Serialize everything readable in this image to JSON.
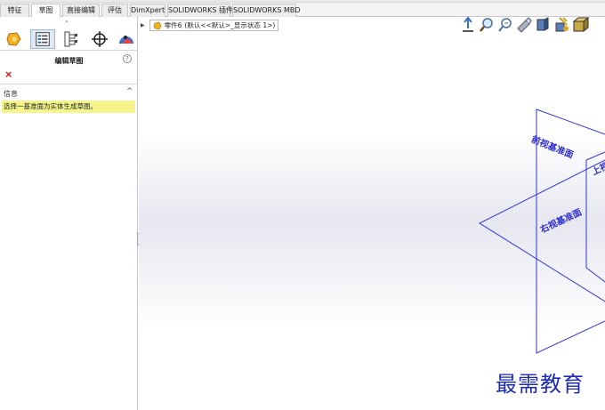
{
  "tabs": [
    {
      "label": "特征",
      "active": false
    },
    {
      "label": "草图",
      "active": true
    },
    {
      "label": "直接编辑",
      "active": false
    },
    {
      "label": "评估",
      "active": false
    },
    {
      "label": "DimXpert",
      "active": false
    },
    {
      "label": "SOLIDWORKS 插件",
      "active": false
    },
    {
      "label": "SOLIDWORKS MBD",
      "active": false
    }
  ],
  "panel": {
    "tick_mark": "»",
    "icon_tabs": [
      "feature-manager-icon",
      "property-manager-icon",
      "configuration-manager-icon",
      "dimxpert-manager-icon",
      "display-manager-icon"
    ],
    "title": "编辑草图",
    "help_icon": "?",
    "close_icon": "×",
    "info_header": "信息",
    "info_message": "选择一基准面为实体生成草图。",
    "collapse_icon": "^"
  },
  "tree": {
    "part_name": "零件6",
    "config_text": "(默认<<默认>_显示状态 1>)"
  },
  "headsup_icons": [
    "view-orientation-icon",
    "zoom-to-fit-icon",
    "zoom-area-icon",
    "previous-view-icon",
    "section-view-icon",
    "dynamic-annotation-icon",
    "display-style-icon"
  ],
  "planes": {
    "front": "前视基准面",
    "top": "上视基准面",
    "right": "右视基准面",
    "color": "#3434d8"
  },
  "watermark": "最需教育",
  "colors": {
    "accent": "#3434d8",
    "info_bg": "#f5f58c",
    "close": "#d01010"
  }
}
